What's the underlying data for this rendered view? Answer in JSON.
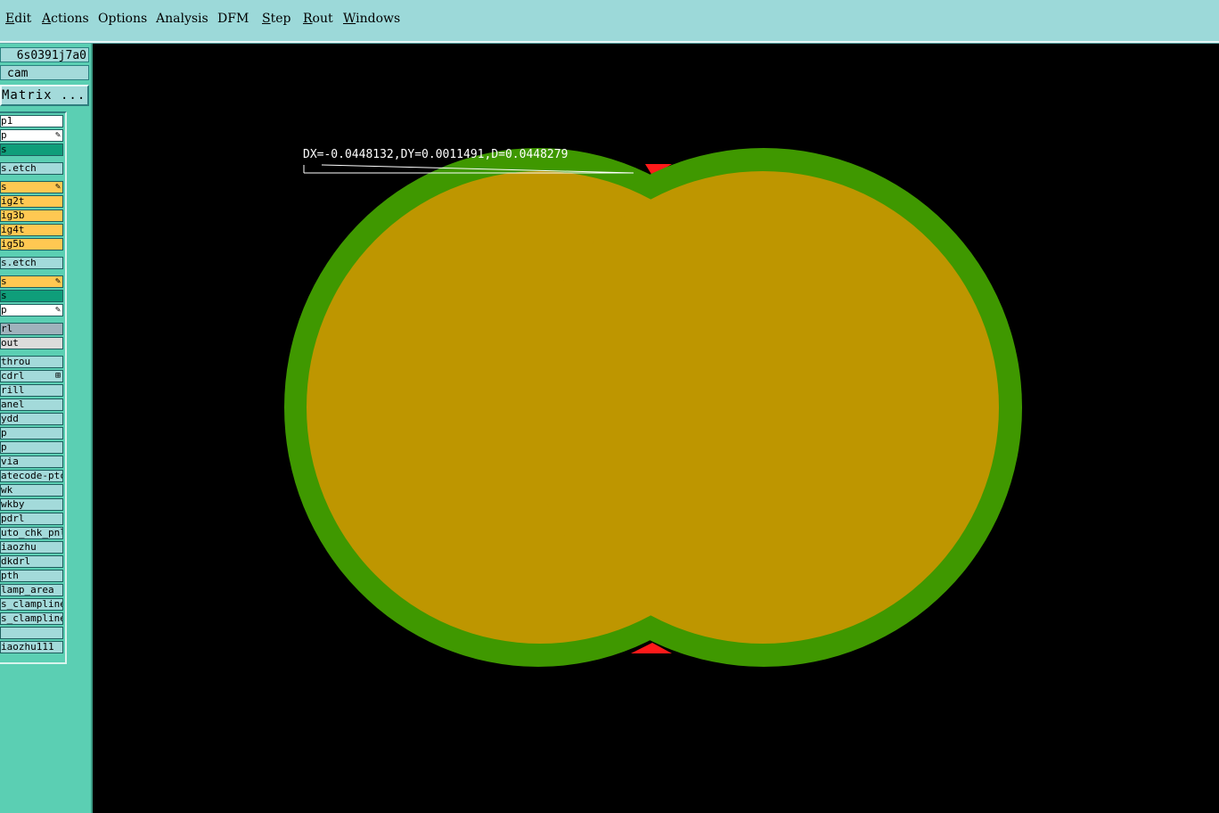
{
  "menu": {
    "items": [
      {
        "label": "Edit",
        "underline": "E"
      },
      {
        "label": "Actions",
        "underline": "A"
      },
      {
        "label": "Options",
        "underline": ""
      },
      {
        "label": "Analysis",
        "underline": ""
      },
      {
        "label": "DFM",
        "underline": ""
      },
      {
        "label": "Step",
        "underline": "S"
      },
      {
        "label": "Rout",
        "underline": "R"
      },
      {
        "label": "Windows",
        "underline": "W"
      }
    ]
  },
  "panel": {
    "job_name": "6s0391j7a0",
    "step_name": "cam",
    "matrix_button": "Matrix ...",
    "layers": [
      {
        "label": "p1",
        "color": "white",
        "mark": ""
      },
      {
        "label": "p",
        "color": "white",
        "mark": "✎"
      },
      {
        "label": "s",
        "color": "green",
        "mark": ""
      },
      {
        "label": "s.etch",
        "color": "cyan",
        "mark": ""
      },
      {
        "label": "s",
        "color": "orange",
        "mark": "✎"
      },
      {
        "label": "ig2t",
        "color": "orange",
        "mark": ""
      },
      {
        "label": "ig3b",
        "color": "orange",
        "mark": ""
      },
      {
        "label": "ig4t",
        "color": "orange",
        "mark": ""
      },
      {
        "label": "ig5b",
        "color": "orange",
        "mark": ""
      },
      {
        "label": "s.etch",
        "color": "cyan",
        "mark": ""
      },
      {
        "label": "s",
        "color": "orange",
        "mark": "✎"
      },
      {
        "label": "s",
        "color": "green",
        "mark": ""
      },
      {
        "label": "p",
        "color": "white",
        "mark": "✎"
      },
      {
        "label": "rl",
        "color": "gray",
        "mark": ""
      },
      {
        "label": "out",
        "color": "lgray",
        "mark": ""
      },
      {
        "label": "throu",
        "color": "cyan",
        "mark": ""
      },
      {
        "label": "cdrl",
        "color": "cyan",
        "mark": "⊞"
      },
      {
        "label": "rill",
        "color": "cyan",
        "mark": ""
      },
      {
        "label": "anel",
        "color": "cyan",
        "mark": ""
      },
      {
        "label": "ydd",
        "color": "cyan",
        "mark": ""
      },
      {
        "label": "p",
        "color": "cyan",
        "mark": ""
      },
      {
        "label": "p",
        "color": "cyan",
        "mark": ""
      },
      {
        "label": "via",
        "color": "cyan",
        "mark": ""
      },
      {
        "label": "atecode-ptc",
        "color": "cyan",
        "mark": ""
      },
      {
        "label": "wk",
        "color": "cyan",
        "mark": ""
      },
      {
        "label": "wkby",
        "color": "cyan",
        "mark": ""
      },
      {
        "label": "pdrl",
        "color": "cyan",
        "mark": ""
      },
      {
        "label": "uto_chk_pnl",
        "color": "cyan",
        "mark": ""
      },
      {
        "label": "iaozhu",
        "color": "cyan",
        "mark": ""
      },
      {
        "label": "dkdrl",
        "color": "cyan",
        "mark": ""
      },
      {
        "label": "pth",
        "color": "cyan",
        "mark": ""
      },
      {
        "label": "lamp_area",
        "color": "cyan",
        "mark": ""
      },
      {
        "label": "s_clampline",
        "color": "cyan",
        "mark": ""
      },
      {
        "label": "s_clampline",
        "color": "cyan",
        "mark": ""
      },
      {
        "label": "",
        "color": "cyan",
        "mark": ""
      },
      {
        "label": "iaozhu111",
        "color": "cyan",
        "mark": ""
      }
    ]
  },
  "canvas": {
    "measurement": "DX=-0.0448132,DY=0.0011491,D=0.0448279",
    "colors": {
      "background": "#000000",
      "outer_layer": "#3f9800",
      "inner_layer": "#be9600",
      "overlap_marker": "#ff1a1a",
      "measure_line": "#ffffff"
    }
  }
}
